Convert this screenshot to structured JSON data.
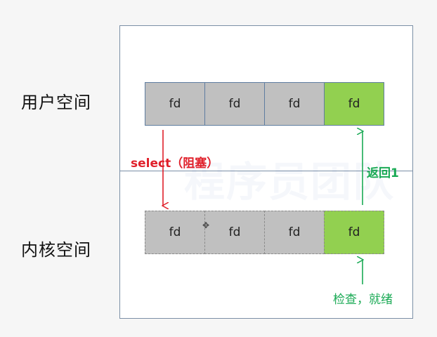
{
  "labels": {
    "user_space": "用户空间",
    "kernel_space": "内核空间"
  },
  "user_row": [
    {
      "text": "fd",
      "ready": false
    },
    {
      "text": "fd",
      "ready": false
    },
    {
      "text": "fd",
      "ready": false
    },
    {
      "text": "fd",
      "ready": true
    }
  ],
  "kernel_row": [
    {
      "text": "fd",
      "ready": false
    },
    {
      "text": "fd",
      "ready": false
    },
    {
      "text": "fd",
      "ready": false
    },
    {
      "text": "fd",
      "ready": true
    }
  ],
  "annotations": {
    "select_blocking": "select（阻塞）",
    "return_one": "返回1",
    "check_ready": "检查，就绪"
  },
  "watermark": "程序员团队",
  "colors": {
    "fd_default": "#c0c0c0",
    "fd_ready": "#92d050",
    "select_arrow": "#e0202a",
    "return_arrow": "#1aaa55",
    "frame_border": "#7b8fa6"
  }
}
